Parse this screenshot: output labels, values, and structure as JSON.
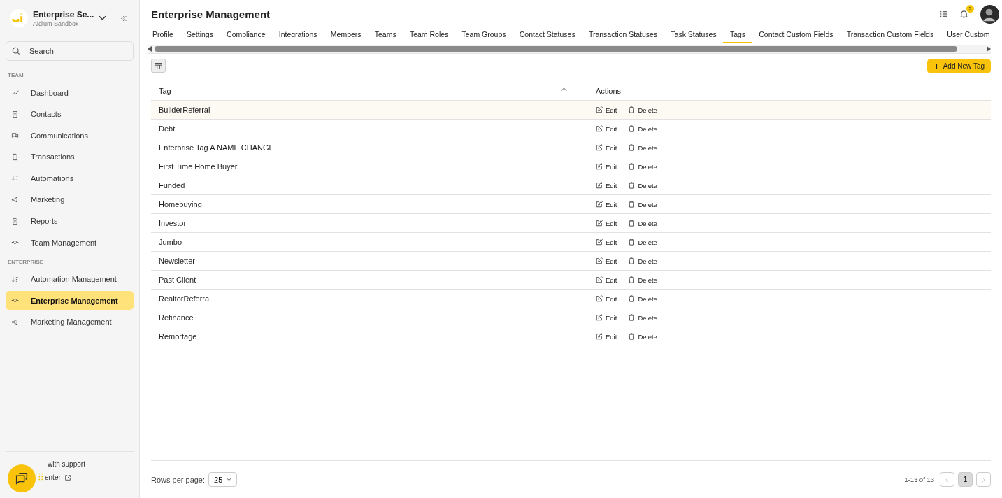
{
  "sidebar": {
    "org_name": "Enterprise Se...",
    "org_sub": "Aidium Sandbox",
    "search": {
      "placeholder": "Search"
    },
    "sections": [
      {
        "heading": "TEAM",
        "items": [
          {
            "label": "Dashboard",
            "selected": false
          },
          {
            "label": "Contacts",
            "selected": false
          },
          {
            "label": "Communications",
            "selected": false
          },
          {
            "label": "Transactions",
            "selected": false
          },
          {
            "label": "Automations",
            "selected": false
          },
          {
            "label": "Marketing",
            "selected": false
          },
          {
            "label": "Reports",
            "selected": false
          },
          {
            "label": "Team Management",
            "selected": false
          }
        ]
      },
      {
        "heading": "ENTERPRISE",
        "items": [
          {
            "label": "Automation Management",
            "selected": false
          },
          {
            "label": "Enterprise Management",
            "selected": true
          },
          {
            "label": "Marketing Management",
            "selected": false
          }
        ]
      }
    ],
    "support": {
      "line_1": "with support",
      "line_2": "enter"
    }
  },
  "header": {
    "title": "Enterprise Management",
    "notification_count": "2"
  },
  "tabs": [
    {
      "label": "Profile",
      "selected": false
    },
    {
      "label": "Settings",
      "selected": false
    },
    {
      "label": "Compliance",
      "selected": false
    },
    {
      "label": "Integrations",
      "selected": false
    },
    {
      "label": "Members",
      "selected": false
    },
    {
      "label": "Teams",
      "selected": false
    },
    {
      "label": "Team Roles",
      "selected": false
    },
    {
      "label": "Team Groups",
      "selected": false
    },
    {
      "label": "Contact Statuses",
      "selected": false
    },
    {
      "label": "Transaction Statuses",
      "selected": false
    },
    {
      "label": "Task Statuses",
      "selected": false
    },
    {
      "label": "Tags",
      "selected": true
    },
    {
      "label": "Contact Custom Fields",
      "selected": false
    },
    {
      "label": "Transaction Custom Fields",
      "selected": false
    },
    {
      "label": "User Custom",
      "selected": false
    }
  ],
  "add_button": "Add New Tag",
  "table": {
    "columns": [
      "Tag",
      "Actions"
    ],
    "rows": [
      {
        "tag": "BuilderReferral",
        "highlighted": true,
        "edit": "Edit",
        "delete": "Delete"
      },
      {
        "tag": "Debt",
        "highlighted": false,
        "edit": "Edit",
        "delete": "Delete"
      },
      {
        "tag": "Enterprise Tag A NAME CHANGE",
        "highlighted": false,
        "edit": "Edit",
        "delete": "Delete"
      },
      {
        "tag": "First Time Home Buyer",
        "highlighted": false,
        "edit": "Edit",
        "delete": "Delete"
      },
      {
        "tag": "Funded",
        "highlighted": false,
        "edit": "Edit",
        "delete": "Delete"
      },
      {
        "tag": "Homebuying",
        "highlighted": false,
        "edit": "Edit",
        "delete": "Delete"
      },
      {
        "tag": "Investor",
        "highlighted": false,
        "edit": "Edit",
        "delete": "Delete"
      },
      {
        "tag": "Jumbo",
        "highlighted": false,
        "edit": "Edit",
        "delete": "Delete"
      },
      {
        "tag": "Newsletter",
        "highlighted": false,
        "edit": "Edit",
        "delete": "Delete"
      },
      {
        "tag": "Past Client",
        "highlighted": false,
        "edit": "Edit",
        "delete": "Delete"
      },
      {
        "tag": "RealtorReferral",
        "highlighted": false,
        "edit": "Edit",
        "delete": "Delete"
      },
      {
        "tag": "Refinance",
        "highlighted": false,
        "edit": "Edit",
        "delete": "Delete"
      },
      {
        "tag": "Remortage",
        "highlighted": false,
        "edit": "Edit",
        "delete": "Delete"
      }
    ]
  },
  "footer": {
    "rows_per_page_label": "Rows per page:",
    "rows_per_page": "25",
    "range": "1-13 of 13",
    "pages": [
      {
        "label": "1",
        "selected": true
      }
    ]
  }
}
